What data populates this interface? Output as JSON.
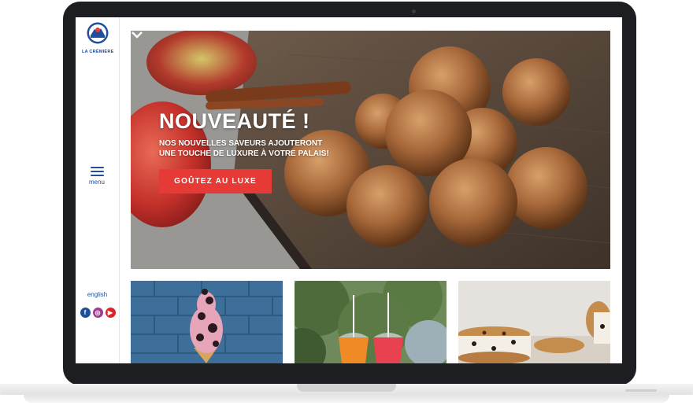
{
  "brand": {
    "name": "LA CRÉMIÈRE",
    "primary_color": "#1f4f9c",
    "accent_color": "#e53a35"
  },
  "sidebar": {
    "menu_label": "menu",
    "menu_icon": "hamburger-icon",
    "language_link": "english",
    "socials": [
      {
        "name": "facebook-icon",
        "glyph": "f"
      },
      {
        "name": "instagram-icon",
        "glyph": "◎"
      },
      {
        "name": "youtube-icon",
        "glyph": "▶"
      }
    ]
  },
  "hero": {
    "title": "NOUVEAUTÉ !",
    "subtitle": "NOS NOUVELLES SAVEURS AJOUTERONT UNE TOUCHE DE LUXURE À VOTRE PALAIS!",
    "cta_label": "GOÛTEZ AU LUXE",
    "scroll_icon": "chevron-down-icon",
    "image": "donut-holes-with-apples-and-cinnamon"
  },
  "tiles": [
    {
      "image": "ice-cream-cone-brick-wall"
    },
    {
      "image": "frozen-drinks-trees"
    },
    {
      "image": "ice-cream-cookie-sandwiches"
    }
  ]
}
